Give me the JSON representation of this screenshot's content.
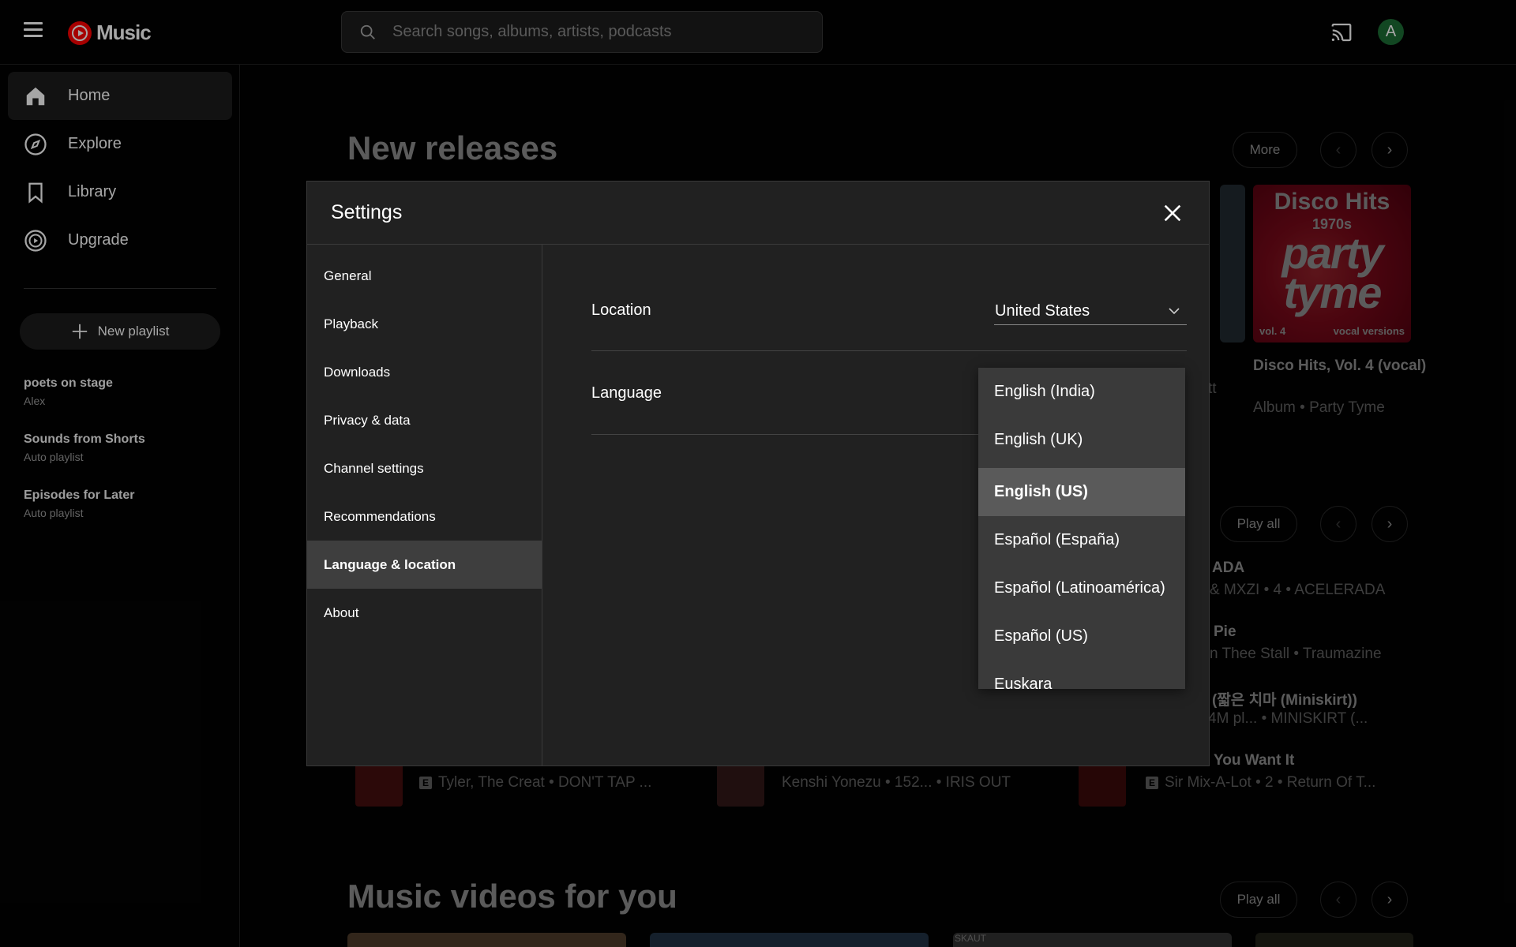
{
  "header": {
    "logo_text": "Music",
    "search_placeholder": "Search songs, albums, artists, podcasts",
    "avatar_letter": "A"
  },
  "sidebar": {
    "nav": [
      {
        "label": "Home",
        "icon": "home-icon",
        "active": true
      },
      {
        "label": "Explore",
        "icon": "compass-icon",
        "active": false
      },
      {
        "label": "Library",
        "icon": "bookmark-icon",
        "active": false
      },
      {
        "label": "Upgrade",
        "icon": "upgrade-icon",
        "active": false
      }
    ],
    "new_playlist_label": "New playlist",
    "playlists": [
      {
        "title": "poets on stage",
        "subtitle": "Alex"
      },
      {
        "title": "Sounds from Shorts",
        "subtitle": "Auto playlist"
      },
      {
        "title": "Episodes for Later",
        "subtitle": "Auto playlist"
      }
    ]
  },
  "main": {
    "new_releases_title": "New releases",
    "more_label": "More",
    "card": {
      "art_line1": "Disco Hits",
      "art_line2": "1970s",
      "art_line3": "party tyme",
      "art_vol": "vol. 4",
      "art_vocal": "vocal versions",
      "title": "Disco Hits, Vol. 4 (vocal)",
      "subtitle": "Album • Party Tyme",
      "partial_text": "tt"
    },
    "play_all_label": "Play all",
    "song_rows": [
      {
        "title": "ADA",
        "sub": "& MXZI • 4 • ACELERADA"
      },
      {
        "title": "Pie",
        "sub": "n Thee Stall • Traumazine"
      },
      {
        "title": "(짧은 치마 (Miniskirt))",
        "sub": "4M pl... • MINISKIRT (..."
      },
      {
        "title": "You Want It",
        "sub": "Sir Mix-A-Lot • 2 • Return Of T..."
      }
    ],
    "bottom_rows": [
      {
        "sub": "Tyler, The Creat • DON'T TAP ..."
      },
      {
        "sub": "Kenshi Yonezu • 152... • IRIS OUT"
      }
    ],
    "explicit_badge": "E",
    "music_videos_title": "Music videos for you",
    "video_overlay_text": "SKAUT"
  },
  "settings": {
    "title": "Settings",
    "nav": [
      {
        "label": "General",
        "active": false
      },
      {
        "label": "Playback",
        "active": false
      },
      {
        "label": "Downloads",
        "active": false
      },
      {
        "label": "Privacy & data",
        "active": false
      },
      {
        "label": "Channel settings",
        "active": false
      },
      {
        "label": "Recommendations",
        "active": false
      },
      {
        "label": "Language & location",
        "active": true
      },
      {
        "label": "About",
        "active": false
      }
    ],
    "location_label": "Location",
    "location_value": "United States",
    "language_label": "Language",
    "language_options": [
      {
        "label": "English (India)",
        "selected": false
      },
      {
        "label": "English (UK)",
        "selected": false
      },
      {
        "label": "English (US)",
        "selected": true
      },
      {
        "label": "Español (España)",
        "selected": false
      },
      {
        "label": "Español (Latinoamérica)",
        "selected": false
      },
      {
        "label": "Español (US)",
        "selected": false
      },
      {
        "label": "Euskara",
        "selected": false
      }
    ]
  },
  "colors": {
    "background": "#030303",
    "dialog": "#212121",
    "accent_red": "#ff0000",
    "avatar_green": "#1c6d35"
  }
}
